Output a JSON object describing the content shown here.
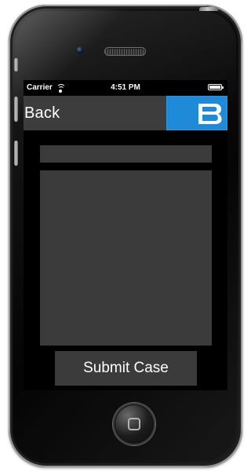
{
  "device": {
    "home_icon": "home-square-icon"
  },
  "status_bar": {
    "carrier": "Carrier",
    "time": "4:51 PM",
    "wifi_icon": "wifi-icon",
    "battery_icon": "battery-icon"
  },
  "nav_bar": {
    "back_label": "Back",
    "logo_icon": "brand-b-logo",
    "logo_color": "#1F8AD8"
  },
  "form": {
    "subject": {
      "value": "",
      "placeholder": ""
    },
    "description": {
      "value": "",
      "placeholder": ""
    },
    "submit_label": "Submit Case"
  },
  "colors": {
    "screen_background": "#000000",
    "nav_background": "#3D3D3D",
    "field_background": "#3B3B3B",
    "text": "#FFFFFF",
    "device_frame": "#111111"
  }
}
